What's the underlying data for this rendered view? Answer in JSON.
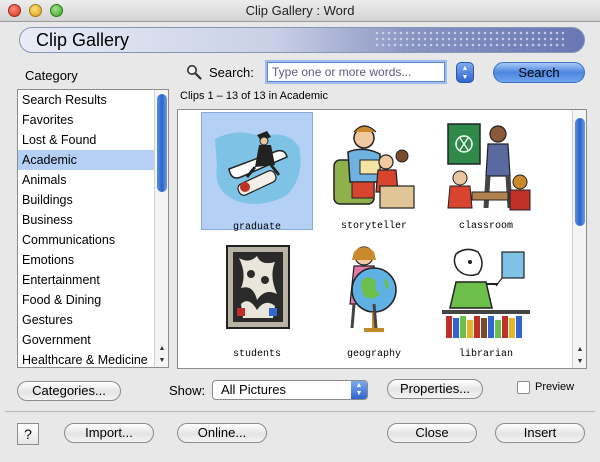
{
  "window": {
    "title": "Clip Gallery : Word"
  },
  "banner": {
    "title": "Clip Gallery"
  },
  "category": {
    "heading": "Category",
    "items": [
      "Search Results",
      "Favorites",
      "Lost & Found",
      "Academic",
      "Animals",
      "Buildings",
      "Business",
      "Communications",
      "Emotions",
      "Entertainment",
      "Food & Dining",
      "Gestures",
      "Government",
      "Healthcare & Medicine"
    ],
    "selected": "Academic"
  },
  "search": {
    "label": "Search:",
    "placeholder": "Type one or more words...",
    "button": "Search"
  },
  "clips_info": "Clips 1 – 13 of 13 in Academic",
  "clips": [
    {
      "caption": "graduate",
      "icon": "graduate-clipart-icon"
    },
    {
      "caption": "storyteller",
      "icon": "storyteller-clipart-icon"
    },
    {
      "caption": "classroom",
      "icon": "classroom-clipart-icon"
    },
    {
      "caption": "students",
      "icon": "students-clipart-icon"
    },
    {
      "caption": "geography",
      "icon": "geography-clipart-icon"
    },
    {
      "caption": "librarian",
      "icon": "librarian-clipart-icon"
    }
  ],
  "controls": {
    "categories_button": "Categories...",
    "show_label": "Show:",
    "show_value": "All Pictures",
    "properties_button": "Properties...",
    "preview_label": "Preview",
    "help_label": "?",
    "import_button": "Import...",
    "online_button": "Online...",
    "close_button": "Close",
    "insert_button": "Insert"
  },
  "colors": {
    "selection": "#b5d0f5",
    "accent_blue": "#2f66cf"
  }
}
